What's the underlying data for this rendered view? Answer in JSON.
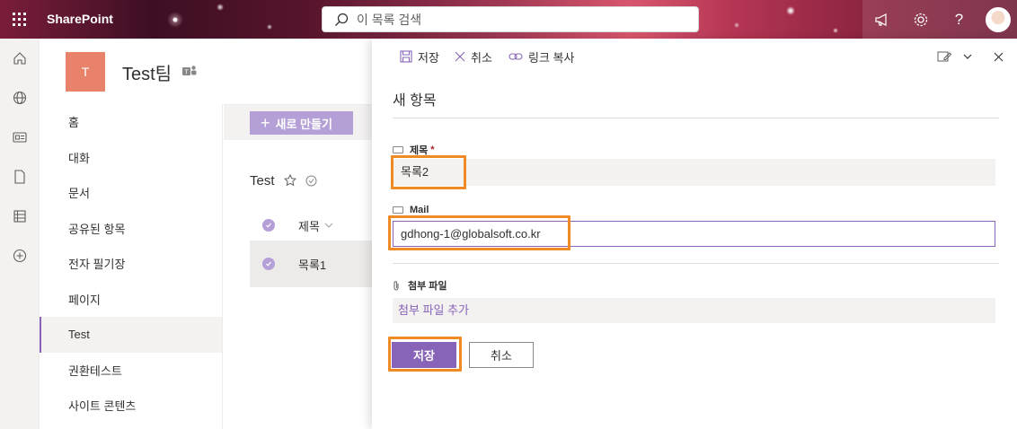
{
  "suitebar": {
    "brand": "SharePoint",
    "search_placeholder": "이 목록 검색",
    "icons": [
      "waffle-icon",
      "search-icon",
      "megaphone-icon",
      "gear-icon",
      "help-icon",
      "avatar"
    ]
  },
  "site": {
    "logo_letter": "T",
    "title": "Test팀"
  },
  "leftnav": {
    "items": [
      {
        "label": "홈"
      },
      {
        "label": "대화"
      },
      {
        "label": "문서"
      },
      {
        "label": "공유된 항목"
      },
      {
        "label": "전자 필기장"
      },
      {
        "label": "페이지"
      },
      {
        "label": "Test",
        "selected": true
      },
      {
        "label": "권환테스트"
      },
      {
        "label": "사이트 콘텐츠"
      }
    ]
  },
  "list": {
    "new_button": "새로 만들기",
    "title": "Test",
    "column_title": "제목",
    "row_title": "목록1"
  },
  "panel": {
    "toolbar": {
      "save": "저장",
      "cancel": "취소",
      "copy_link": "링크 복사"
    },
    "title": "새 항목",
    "fields": {
      "title_label": "제목",
      "title_required": "*",
      "title_value": "목록2",
      "mail_label": "Mail",
      "mail_value": "gdhong-1@globalsoft.co.kr",
      "attach_label": "첨부 파일",
      "attach_link": "첨부 파일 추가"
    },
    "buttons": {
      "save": "저장",
      "cancel": "취소"
    }
  },
  "colors": {
    "accent": "#8764b8",
    "highlight": "#f08a24",
    "site_logo": "#e9826b"
  }
}
